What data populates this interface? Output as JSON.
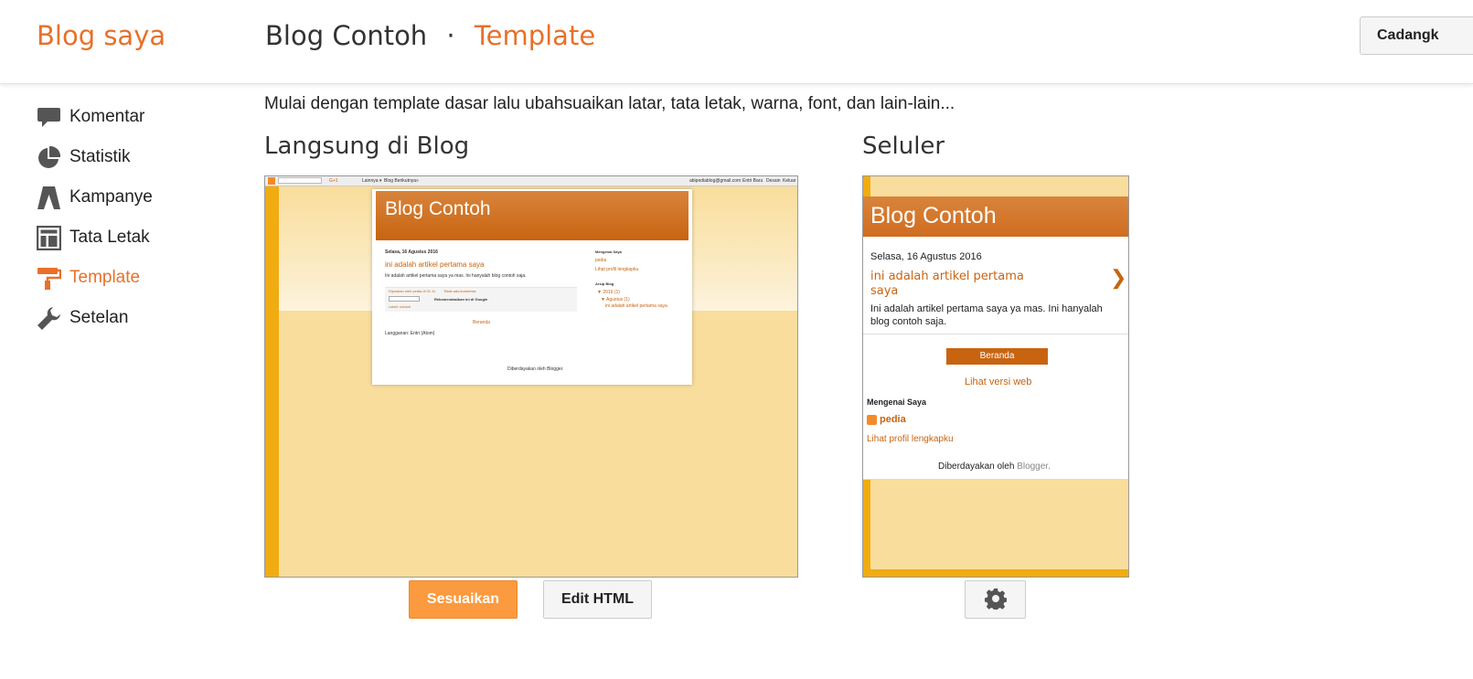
{
  "header": {
    "brand": "Blog saya",
    "blog_name": "Blog Contoh",
    "separator": "·",
    "current_page": "Template",
    "backup_button": "Cadangk"
  },
  "sidebar": {
    "items": [
      {
        "label": "Komentar",
        "icon": "comment-icon"
      },
      {
        "label": "Statistik",
        "icon": "pie-chart-icon"
      },
      {
        "label": "Kampanye",
        "icon": "campaign-icon"
      },
      {
        "label": "Tata Letak",
        "icon": "layout-icon"
      },
      {
        "label": "Template",
        "icon": "paint-roller-icon",
        "active": true
      },
      {
        "label": "Setelan",
        "icon": "wrench-icon"
      }
    ]
  },
  "main": {
    "intro": "Mulai dengan template dasar lalu ubahsuaikan latar, tata letak, warna, font, dan lain-lain...",
    "live_title": "Langsung di Blog",
    "mobile_title": "Seluler",
    "customize_button": "Sesuaikan",
    "edit_html_button": "Edit HTML"
  },
  "desktop_preview": {
    "navbar": {
      "search_button": "G+1",
      "more": "Lainnya ▾",
      "next_blog": "Blog Berikutnya»",
      "email": "abipediablog@gmail.com",
      "new_post": "Entri Baru",
      "design": "Desain",
      "logout": "Keluar"
    },
    "blog_title": "Blog Contoh",
    "post_date": "Selasa, 16 Agustus 2016",
    "post_title": "ini adalah artikel pertama saya",
    "post_body": "Ini adalah artikel pertama saya ya mas. Ini hanyalah blog contoh saja.",
    "post_footer": "Diposkan oleh pedia di 01.11",
    "no_comment": "Tidak ada komentar:",
    "recommend": "Rekomendasikan ini di Google",
    "labels": "Label: contoh",
    "home": "Beranda",
    "subscribe": "Langganan: Entri (Atom)",
    "powered": "Diberdayakan oleh Blogger.",
    "about_title": "Mengenai Saya",
    "about_name": "pedia",
    "about_link": "Lihat profil lengkapku",
    "archive_title": "Arsip Blog",
    "archive_year": "▼ 2016 (1)",
    "archive_month": "▼ Agustus (1)",
    "archive_post": "ini adalah artikel pertama saya"
  },
  "mobile_preview": {
    "blog_title": "Blog Contoh",
    "post_date": "Selasa, 16 Agustus 2016",
    "post_title_line1": "ini adalah artikel pertama",
    "post_title_line2": "saya",
    "arrow": "❯",
    "post_body_line1": "Ini adalah artikel pertama saya ya mas. Ini hanyalah",
    "post_body_line2": "blog contoh saja.",
    "home_button": "Beranda",
    "web_version": "Lihat versi web",
    "about_title": "Mengenai Saya",
    "about_name": "pedia",
    "about_link": "Lihat profil lengkapku",
    "powered_prefix": "Diberdayakan oleh",
    "powered_link": "Blogger."
  },
  "colors": {
    "accent": "#e8702a",
    "header_orange": "#c86410",
    "background_yellow": "#f9dd9c",
    "stripe_yellow": "#f0ac10",
    "primary_button": "#fb9a3e"
  }
}
